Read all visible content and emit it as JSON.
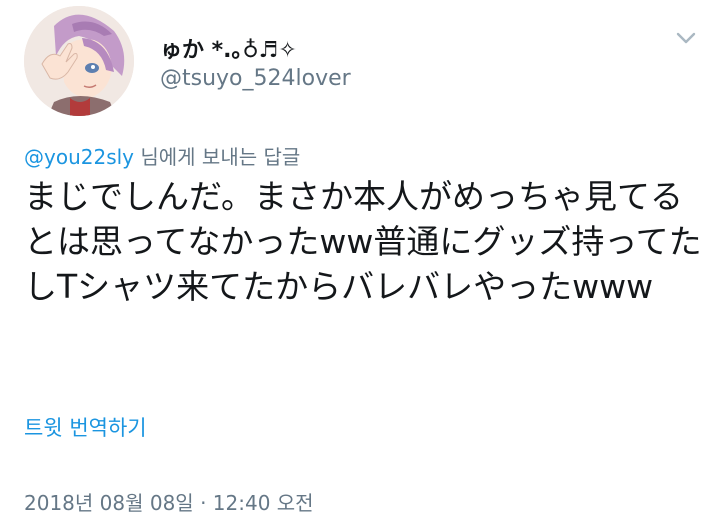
{
  "user": {
    "display_name": "ゅか *.｡♁♬✧",
    "handle": "@tsuyo_524lover"
  },
  "reply": {
    "mention": "@you22sly",
    "suffix": " 님에게 보내는 답글"
  },
  "tweet": {
    "text": "まじでしんだ。まさか本人がめっちゃ見てるとは思ってなかったww普通にグッズ持ってたしTシャツ来てたからバレバレやったwww",
    "translate_label": "트윗 번역하기",
    "timestamp": "2018년 08월 08일 · 12:40 오전"
  },
  "icons": {
    "menu": "chevron-down-icon",
    "avatar": "avatar-illustration"
  },
  "colors": {
    "link": "#1b95e0",
    "secondary": "#657786",
    "text": "#14171a"
  }
}
